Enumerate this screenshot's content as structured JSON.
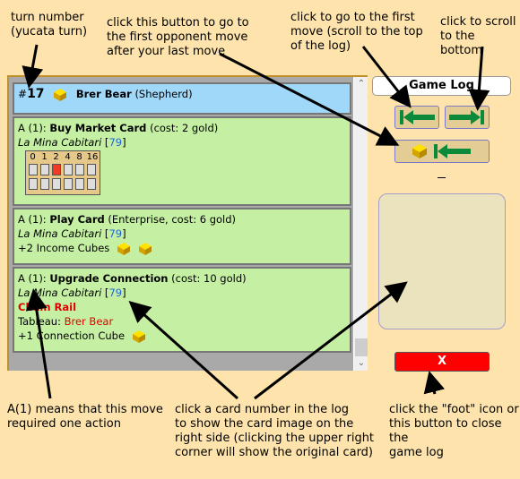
{
  "annotations": {
    "turn_number": [
      "turn number",
      "(yucata turn)"
    ],
    "first_opponent_move": [
      "click this button to go to",
      "the first opponent move",
      "after your last move"
    ],
    "first_move": [
      "click to go to the first",
      "move (scroll to the top",
      "of the log)"
    ],
    "scroll_bottom": [
      "click to scroll",
      "to the bottom"
    ],
    "action_note": [
      "A(1) means that this move",
      "required one action"
    ],
    "card_number_note": [
      "click a card number in the log",
      "to show the card image on the",
      "right side (clicking the upper right",
      "corner will show the original card)"
    ],
    "close_note": [
      "click the \"foot\" icon or",
      "this button to close the",
      "game log"
    ]
  },
  "game_log": {
    "title": "Game Log",
    "close_label": "X",
    "turn": {
      "number_prefix": "#",
      "number": "17",
      "player": "Brer Bear",
      "role": "(Shepherd)"
    },
    "entries": [
      {
        "prefix": "A (1): ",
        "action": "Buy Market Card",
        "detail": " (cost: 2 gold)",
        "card_name": "La Mina Cabitari",
        "card_number": "79",
        "track": {
          "labels": [
            "0",
            "1",
            "2",
            "4",
            "8",
            "16"
          ],
          "active_value": "2"
        }
      },
      {
        "prefix": "A (1): ",
        "action": "Play Card",
        "detail": " (Enterprise, cost: 6 gold)",
        "card_name": "La Mina Cabitari",
        "card_number": "79",
        "result": "+2 Income Cubes",
        "cube_count": 2
      },
      {
        "prefix": "A (1): ",
        "action": "Upgrade Connection",
        "detail": " (cost: 10 gold)",
        "card_name": "La Mina Cabitari",
        "card_number": "79",
        "connection": "Chain Rail",
        "tableau_label": "Tableau: ",
        "tableau_owner": "Brer Bear",
        "result": "+1 Connection Cube",
        "cube_count": 1
      }
    ]
  },
  "colors": {
    "background": "#fee4ac",
    "turn_row": "#a0d8fa",
    "move_row": "#c5f0a4",
    "nav_arrow": "#0a8a3a",
    "close_button": "#ff0000",
    "cube": "#f2c200"
  }
}
